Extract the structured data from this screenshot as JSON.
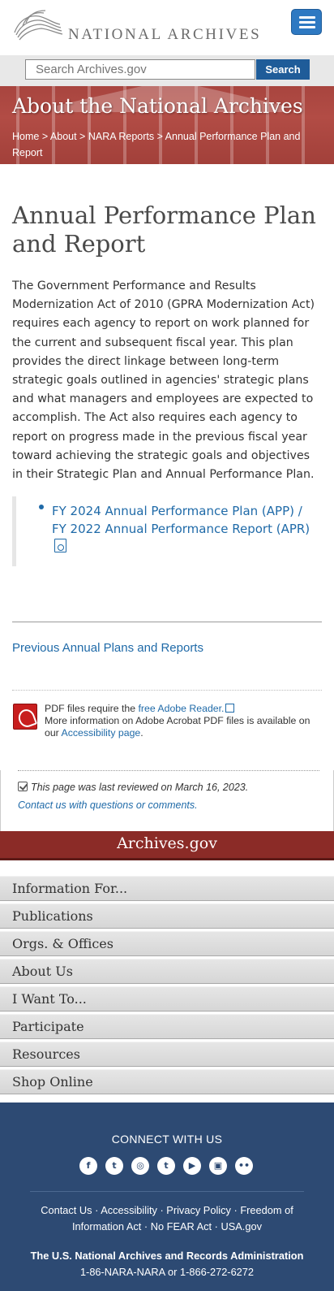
{
  "header": {
    "logo_text": "NATIONAL ARCHIVES",
    "menu_icon": "hamburger-menu-icon"
  },
  "search": {
    "placeholder": "Search Archives.gov",
    "button_label": "Search"
  },
  "banner": {
    "title": "About the National Archives",
    "breadcrumb": [
      "Home",
      "About",
      "NARA Reports",
      "Annual Performance Plan and Report"
    ],
    "separator": " > "
  },
  "main": {
    "title": "Annual Performance Plan and Report",
    "intro": "The Government Performance and Results Modernization Act of 2010 (GPRA Modernization Act) requires each agency to report on work planned for the current and subsequent fiscal year.  This plan provides the direct linkage between long-term strategic goals outlined in agencies' strategic plans and what managers and employees are expected to accomplish. The Act also requires each agency to report on progress made in the previous fiscal year toward achieving the strategic goals and objectives in their Strategic Plan and Annual Performance Plan.",
    "callout_link": "FY 2024 Annual Performance Plan (APP) / FY 2022 Annual Performance Report (APR)",
    "previous_link": "Previous Annual Plans and Reports",
    "pdf_note": {
      "prefix": "PDF files require the ",
      "reader_link": "free Adobe Reader.",
      "middle": "More information on Adobe Acrobat PDF files is available on our ",
      "accessibility_link": "Accessibility page",
      "suffix": "."
    },
    "review": {
      "last_reviewed": "This page was last reviewed on March 16, 2023.",
      "contact_link": "Contact us with questions or comments."
    }
  },
  "footer_nav": {
    "title": "Archives.gov",
    "items": [
      "Information For...",
      "Publications",
      "Orgs. & Offices",
      "About Us",
      "I Want To...",
      "Participate",
      "Resources",
      "Shop Online"
    ]
  },
  "footer": {
    "connect_heading": "CONNECT WITH US",
    "social_icons": [
      "facebook-icon",
      "twitter-icon",
      "instagram-icon",
      "tumblr-icon",
      "youtube-icon",
      "blogs-icon",
      "flickr-icon"
    ],
    "social_glyphs": [
      "f",
      "t",
      "◎",
      "t",
      "▶",
      "▣",
      "••"
    ],
    "links": [
      "Contact Us",
      "Accessibility",
      "Privacy Policy",
      "Freedom of Information Act",
      "No FEAR Act",
      "USA.gov"
    ],
    "org": "The U.S. National Archives and Records Administration",
    "phone": "1-86-NARA-NARA or 1-866-272-6272"
  },
  "colors": {
    "link": "#1f6aa8",
    "banner": "#a8453f",
    "footer_bg": "#2d4a73",
    "archives_bar": "#8b2b27"
  }
}
